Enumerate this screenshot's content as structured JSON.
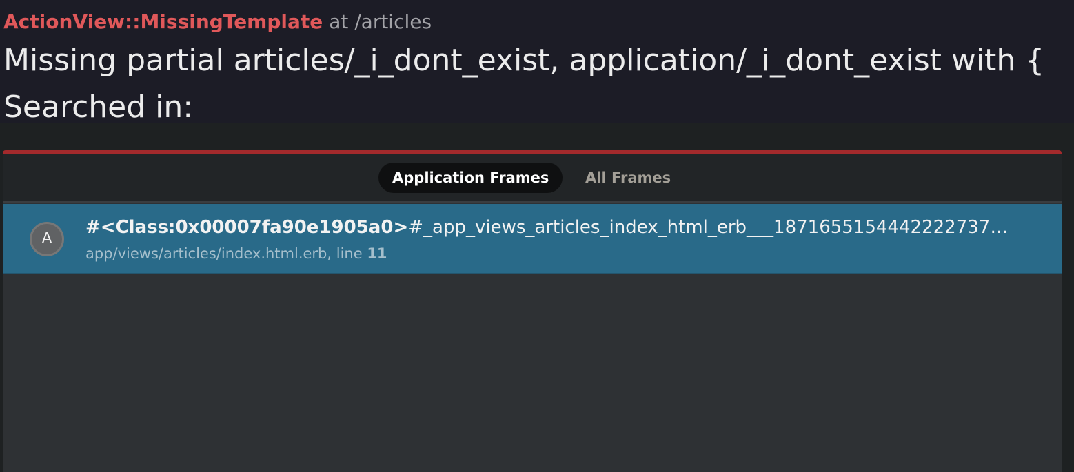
{
  "header": {
    "exception_class": "ActionView::MissingTemplate",
    "location": "at /articles",
    "message_line1": "Missing partial articles/_i_dont_exist, application/_i_dont_exist with {",
    "message_line2": "Searched in:"
  },
  "frames": {
    "tabs": [
      {
        "label": "Application Frames",
        "active": true
      },
      {
        "label": "All Frames",
        "active": false
      }
    ],
    "items": [
      {
        "avatar": "A",
        "class_name": "#<Class:0x00007fa90e1905a0>",
        "method": "#_app_views_articles_index_html_erb___1871655154442222737…",
        "file": "app/views/articles/index.html.erb, line ",
        "line": "11"
      }
    ]
  },
  "colors": {
    "accent_red": "#e0585a",
    "panel_border": "#a32a2c",
    "selected_frame": "#296a89"
  }
}
